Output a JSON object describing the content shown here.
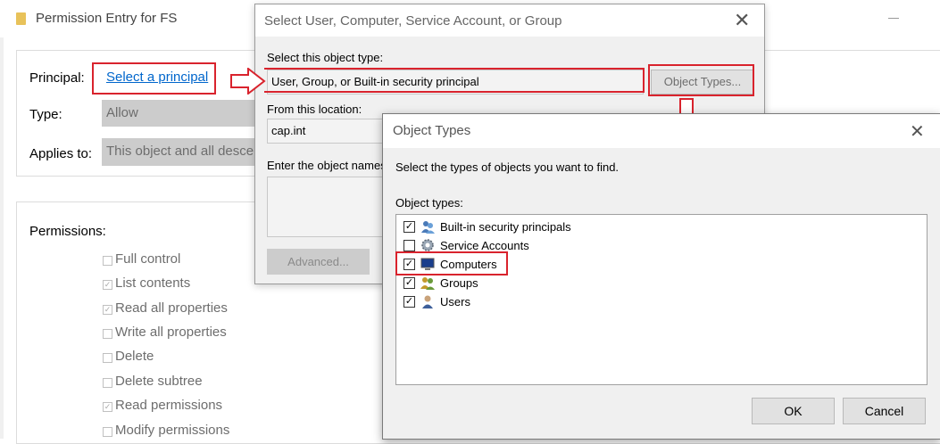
{
  "perm": {
    "title": "Permission Entry for FS",
    "close": "—",
    "principal_label": "Principal:",
    "principal_link": "Select a principal",
    "type_label": "Type:",
    "type_value": "Allow",
    "applies_label": "Applies to:",
    "applies_value": "This object and all descendant objects",
    "permissions_label": "Permissions:",
    "permissions": [
      {
        "label": "Full control",
        "checked": false
      },
      {
        "label": "List contents",
        "checked": true
      },
      {
        "label": "Read all properties",
        "checked": true
      },
      {
        "label": "Write all properties",
        "checked": false
      },
      {
        "label": "Delete",
        "checked": false
      },
      {
        "label": "Delete subtree",
        "checked": false
      },
      {
        "label": "Read permissions",
        "checked": true
      },
      {
        "label": "Modify permissions",
        "checked": false
      }
    ]
  },
  "select": {
    "title": "Select User, Computer, Service Account, or Group",
    "object_type_label": "Select this object type:",
    "object_type_value": "User, Group, or Built-in security principal",
    "object_types_button": "Object Types...",
    "location_label": "From this location:",
    "location_value": "cap.int",
    "enter_names_label": "Enter the object names to select",
    "advanced_button": "Advanced..."
  },
  "objtypes": {
    "title": "Object Types",
    "instruction": "Select the types of objects you want to find.",
    "list_label": "Object types:",
    "items": [
      {
        "label": "Built-in security principals",
        "checked": true,
        "icon": "security-principals-icon"
      },
      {
        "label": "Service Accounts",
        "checked": false,
        "icon": "service-accounts-icon"
      },
      {
        "label": "Computers",
        "checked": true,
        "icon": "computer-icon"
      },
      {
        "label": "Groups",
        "checked": true,
        "icon": "groups-icon"
      },
      {
        "label": "Users",
        "checked": true,
        "icon": "user-icon"
      }
    ],
    "ok_button": "OK",
    "cancel_button": "Cancel"
  },
  "colors": {
    "highlight": "#d9232d",
    "link": "#0066cc"
  }
}
